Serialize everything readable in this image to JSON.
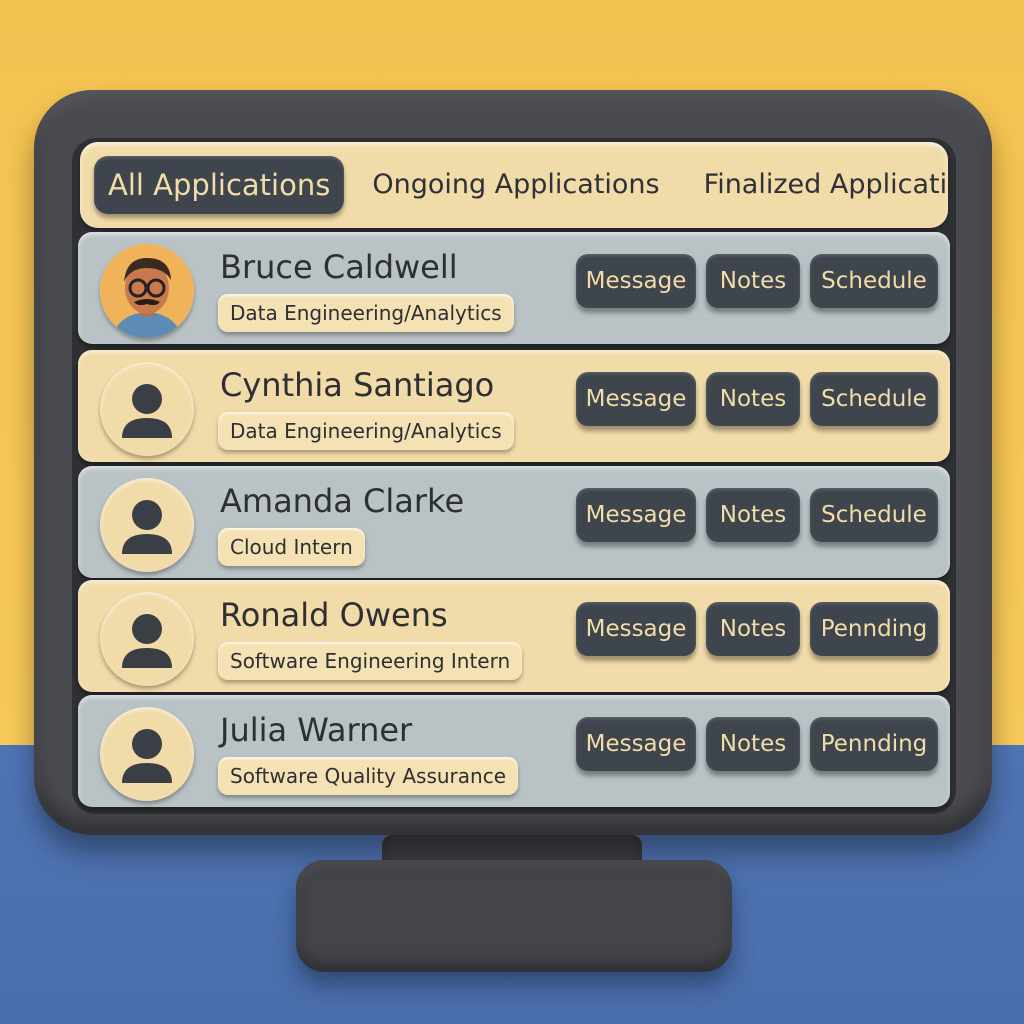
{
  "tabs": [
    {
      "label": "All Applications",
      "active": true
    },
    {
      "label": "Ongoing Applications",
      "active": false
    },
    {
      "label": "Finalized Applicatio",
      "active": false
    }
  ],
  "applicants": [
    {
      "name": "Bruce Caldwell",
      "role": "Data Engineering/Analytics",
      "avatar": "illustrated-man-with-glasses",
      "message_label": "Message",
      "notes_label": "Notes",
      "action_label": "Schedule"
    },
    {
      "name": "Cynthia Santiago",
      "role": "Data Engineering/Analytics",
      "avatar": "person-silhouette-icon",
      "message_label": "Message",
      "notes_label": "Notes",
      "action_label": "Schedule"
    },
    {
      "name": "Amanda Clarke",
      "role": "Cloud Intern",
      "avatar": "person-silhouette-icon",
      "message_label": "Message",
      "notes_label": "Notes",
      "action_label": "Schedule"
    },
    {
      "name": "Ronald Owens",
      "role": "Software Engineering Intern",
      "avatar": "person-silhouette-icon",
      "message_label": "Message",
      "notes_label": "Notes",
      "action_label": "Pennding"
    },
    {
      "name": "Julia Warner",
      "role": "Software Quality Assurance",
      "avatar": "person-silhouette-icon",
      "message_label": "Message",
      "notes_label": "Notes",
      "action_label": "Pennding"
    }
  ],
  "colors": {
    "background_wall": "#f3c24f",
    "desk": "#4f74b3",
    "bezel": "#4a4b50",
    "row_blue": "#b9c2c5",
    "row_cream": "#f1dba9",
    "button_dark": "#3f454d",
    "button_text": "#f2dca8"
  }
}
